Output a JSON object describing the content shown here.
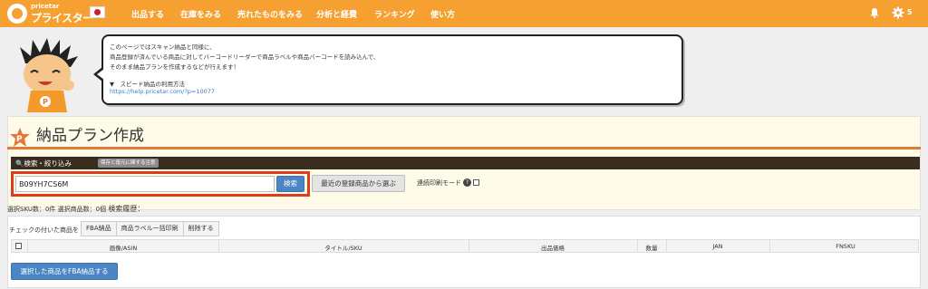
{
  "header": {
    "logo_small": "pricetar",
    "logo_big": "プライスター",
    "nav": [
      {
        "label": "出品する"
      },
      {
        "label": "在庫をみる"
      },
      {
        "label": "売れたものをみる"
      },
      {
        "label": "分析と経費"
      },
      {
        "label": "ランキング"
      },
      {
        "label": "使い方"
      }
    ],
    "settings_count": "5",
    "accent_color": "#f5a031"
  },
  "bubble": {
    "lines": [
      "このページではスキャン納品と同様に、",
      "商品登録が済んでいる商品に対してバーコードリーダーで商品ラベルや商品バーコードを読み込んで、",
      "そのまま納品プランを作成するなどが行えます！"
    ],
    "method_label": "▼　スピード納品の利用方法",
    "link": "https://help.pricetar.com/?p=10077"
  },
  "page": {
    "title": "納品プラン作成",
    "badge_letter": "P"
  },
  "search": {
    "section_label": "検索・絞り込み",
    "note_badge": "保存と復元に関する注意",
    "input_value": "B09YH7CS6M",
    "search_button": "検索",
    "recent_button": "最近の登録商品から選ぶ",
    "print_mode_label": "連続印刷モード"
  },
  "selection": {
    "sku_label": "選択SKU数：0件",
    "items_label": "選択商品数：0個",
    "history_label": "検索履歴："
  },
  "table": {
    "check_label": "チェックの付いた商品を",
    "actions": [
      "FBA納品",
      "商品ラベル一括印刷",
      "削除する"
    ],
    "columns": [
      "画像/ASIN",
      "タイトル/SKU",
      "出品価格",
      "数量",
      "JAN",
      "FNSKU"
    ],
    "submit_button": "選択した商品をFBA納品する"
  }
}
